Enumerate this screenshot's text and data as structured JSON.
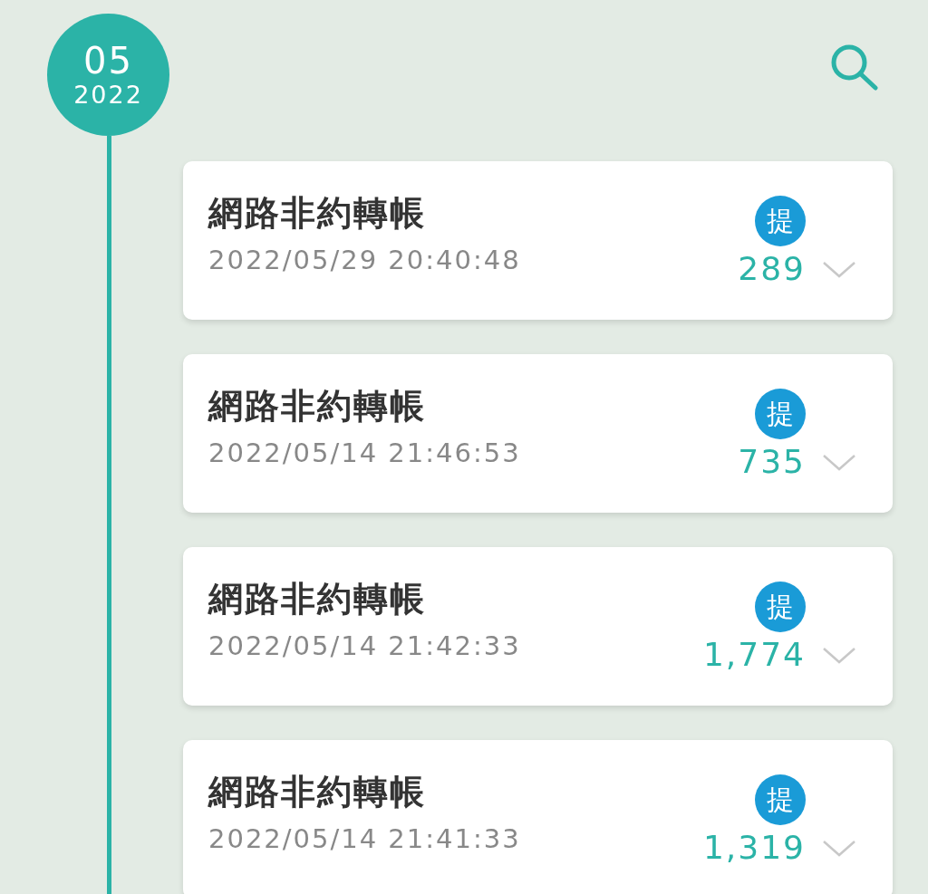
{
  "month_marker": {
    "month": "05",
    "year": "2022"
  },
  "transactions": [
    {
      "title": "網路非約轉帳",
      "datetime": "2022/05/29 20:40:48",
      "badge": "提",
      "amount": "289",
      "expanded": false
    },
    {
      "title": "網路非約轉帳",
      "datetime": "2022/05/14 21:46:53",
      "badge": "提",
      "amount": "735",
      "expanded": false
    },
    {
      "title": "網路非約轉帳",
      "datetime": "2022/05/14 21:42:33",
      "badge": "提",
      "amount": "1,774",
      "expanded": false
    },
    {
      "title": "網路非約轉帳",
      "datetime": "2022/05/14 21:41:33",
      "badge": "提",
      "amount": "1,319",
      "expanded": false
    }
  ]
}
